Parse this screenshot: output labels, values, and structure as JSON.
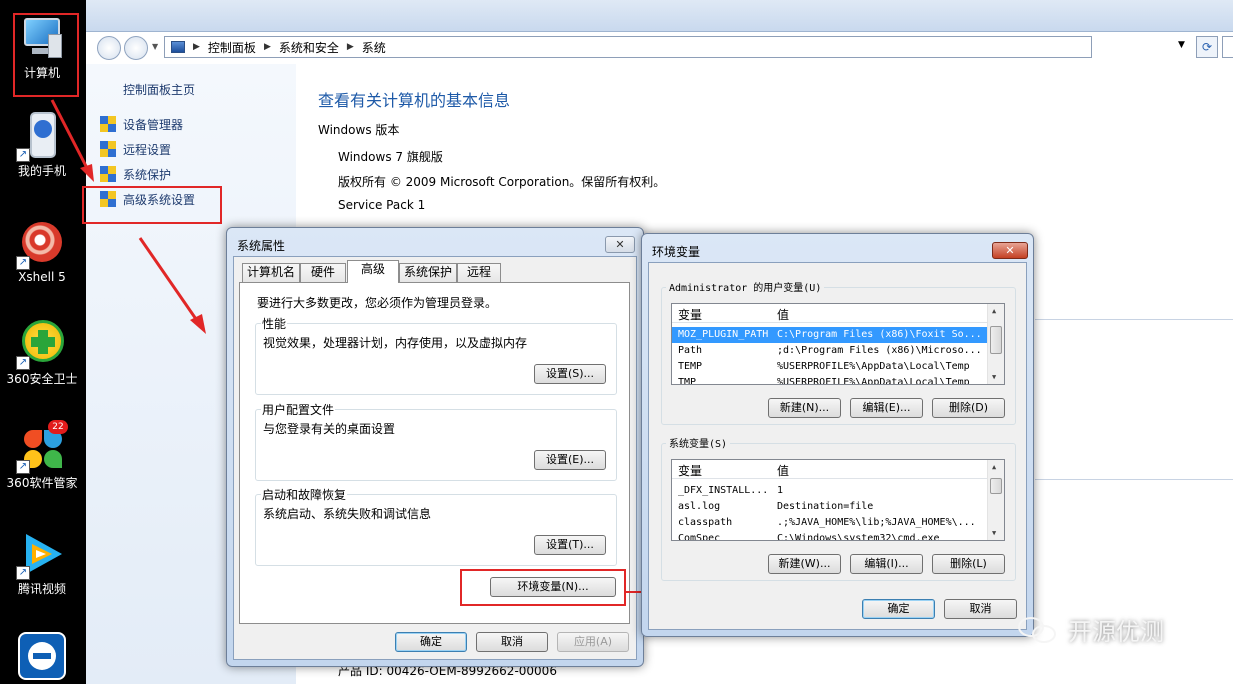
{
  "desktop": {
    "icons": [
      {
        "label": "计算机",
        "icon": "computer-icon"
      },
      {
        "label": "我的手机",
        "icon": "phone-icon"
      },
      {
        "label": "Xshell 5",
        "icon": "xshell-icon"
      },
      {
        "label": "360安全卫士",
        "icon": "360-safe-icon"
      },
      {
        "label": "360软件管家",
        "icon": "360-software-icon",
        "badge": "22"
      },
      {
        "label": "腾讯视频",
        "icon": "tencent-video-icon"
      }
    ]
  },
  "explorer": {
    "breadcrumb": [
      "控制面板",
      "系统和安全",
      "系统"
    ],
    "left_pane": {
      "home": "控制面板主页",
      "items": [
        "设备管理器",
        "远程设置",
        "系统保护",
        "高级系统设置"
      ]
    },
    "main": {
      "title": "查看有关计算机的基本信息",
      "section": "Windows 版本",
      "edition": "Windows 7 旗舰版",
      "copyright": "版权所有 © 2009 Microsoft Corporation。保留所有权利。",
      "service_pack": "Service Pack 1",
      "product_id": "产品 ID: 00426-OEM-8992662-00006"
    }
  },
  "system_properties": {
    "title": "系统属性",
    "tabs": [
      "计算机名",
      "硬件",
      "高级",
      "系统保护",
      "远程"
    ],
    "active_tab": "高级",
    "admin_note": "要进行大多数更改，您必须作为管理员登录。",
    "groups": [
      {
        "label": "性能",
        "desc": "视觉效果，处理器计划，内存使用，以及虚拟内存",
        "button": "设置(S)..."
      },
      {
        "label": "用户配置文件",
        "desc": "与您登录有关的桌面设置",
        "button": "设置(E)..."
      },
      {
        "label": "启动和故障恢复",
        "desc": "系统启动、系统失败和调试信息",
        "button": "设置(T)..."
      }
    ],
    "env_button": "环境变量(N)...",
    "ok": "确定",
    "cancel": "取消",
    "apply": "应用(A)"
  },
  "env_vars": {
    "title": "环境变量",
    "user_group_label": "Administrator 的用户变量(U)",
    "system_group_label": "系统变量(S)",
    "col_var": "变量",
    "col_val": "值",
    "user_vars": [
      {
        "name": "MOZ_PLUGIN_PATH",
        "value": "C:\\Program Files (x86)\\Foxit So...",
        "selected": true
      },
      {
        "name": "Path",
        "value": ";d:\\Program Files (x86)\\Microso..."
      },
      {
        "name": "TEMP",
        "value": "%USERPROFILE%\\AppData\\Local\\Temp"
      },
      {
        "name": "TMP",
        "value": "%USERPROFILE%\\AppData\\Local\\Temp"
      }
    ],
    "system_vars": [
      {
        "name": "_DFX_INSTALL...",
        "value": "1"
      },
      {
        "name": "asl.log",
        "value": "Destination=file"
      },
      {
        "name": "classpath",
        "value": ".;%JAVA_HOME%\\lib;%JAVA_HOME%\\..."
      },
      {
        "name": "ComSpec",
        "value": "C:\\Windows\\system32\\cmd.exe"
      }
    ],
    "user_buttons": {
      "new": "新建(N)...",
      "edit": "编辑(E)...",
      "delete": "删除(D)"
    },
    "system_buttons": {
      "new": "新建(W)...",
      "edit": "编辑(I)...",
      "delete": "删除(L)"
    },
    "ok": "确定",
    "cancel": "取消"
  },
  "watermark": {
    "text": "开源优测"
  },
  "colors": {
    "accent_red": "#e12727",
    "link_blue": "#1e5aa8",
    "selection": "#3399ff"
  }
}
